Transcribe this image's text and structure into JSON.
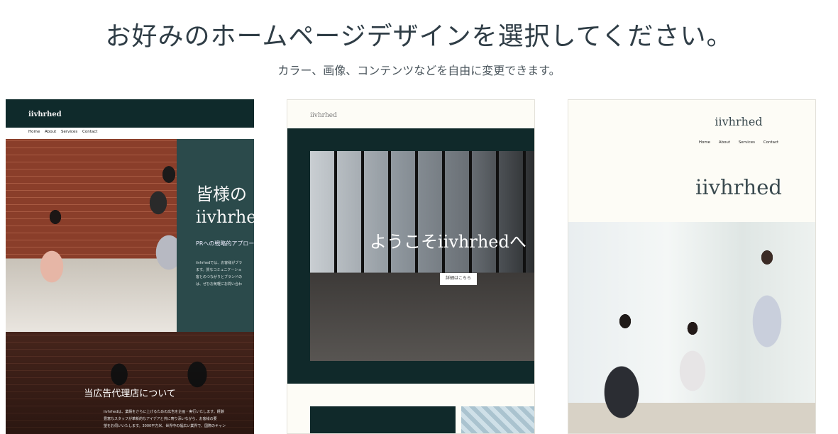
{
  "header": {
    "title": "お好みのホームページデザインを選択してください。",
    "subtitle": "カラー、画像、コンテンツなどを自由に変更できます。"
  },
  "templates": [
    {
      "logo": "iivhrhed",
      "nav": [
        "Home",
        "About",
        "Services",
        "Contact"
      ],
      "hero_line1": "皆様の",
      "hero_line2": "iivhrhe",
      "hero_sub": "PRへの戦略的アプロー",
      "hero_body": [
        "iivhrhedでは、お客様がブラ",
        "ます。質なコミュニケーショ",
        "客とのつながりとブランドの",
        "は、ぜひお気軽にお問い合わ"
      ],
      "about_title": "当広告代理店について",
      "about_body": [
        "iivhrhedは、業績をさらに上げるための広告を企画・実行いたします。経験",
        "豊富なスタッフが革新的なアイデアと共に寄り添いながら、お客様の要",
        "望をお伺いいたします。3000平方米、世界中の幅広い業界で、国際のキャン"
      ]
    },
    {
      "logo": "iivhrhed",
      "hero_title": "ようこそiivhrhedへ",
      "button_label": "詳細はこちら"
    },
    {
      "logo": "iivhrhed",
      "nav": [
        "Home",
        "About",
        "Services",
        "Contact"
      ],
      "hero_title": "iivhrhed"
    }
  ],
  "colors": {
    "dark_teal": "#10292a",
    "teal": "#2b4a4b",
    "cream": "#fdfcf6"
  }
}
